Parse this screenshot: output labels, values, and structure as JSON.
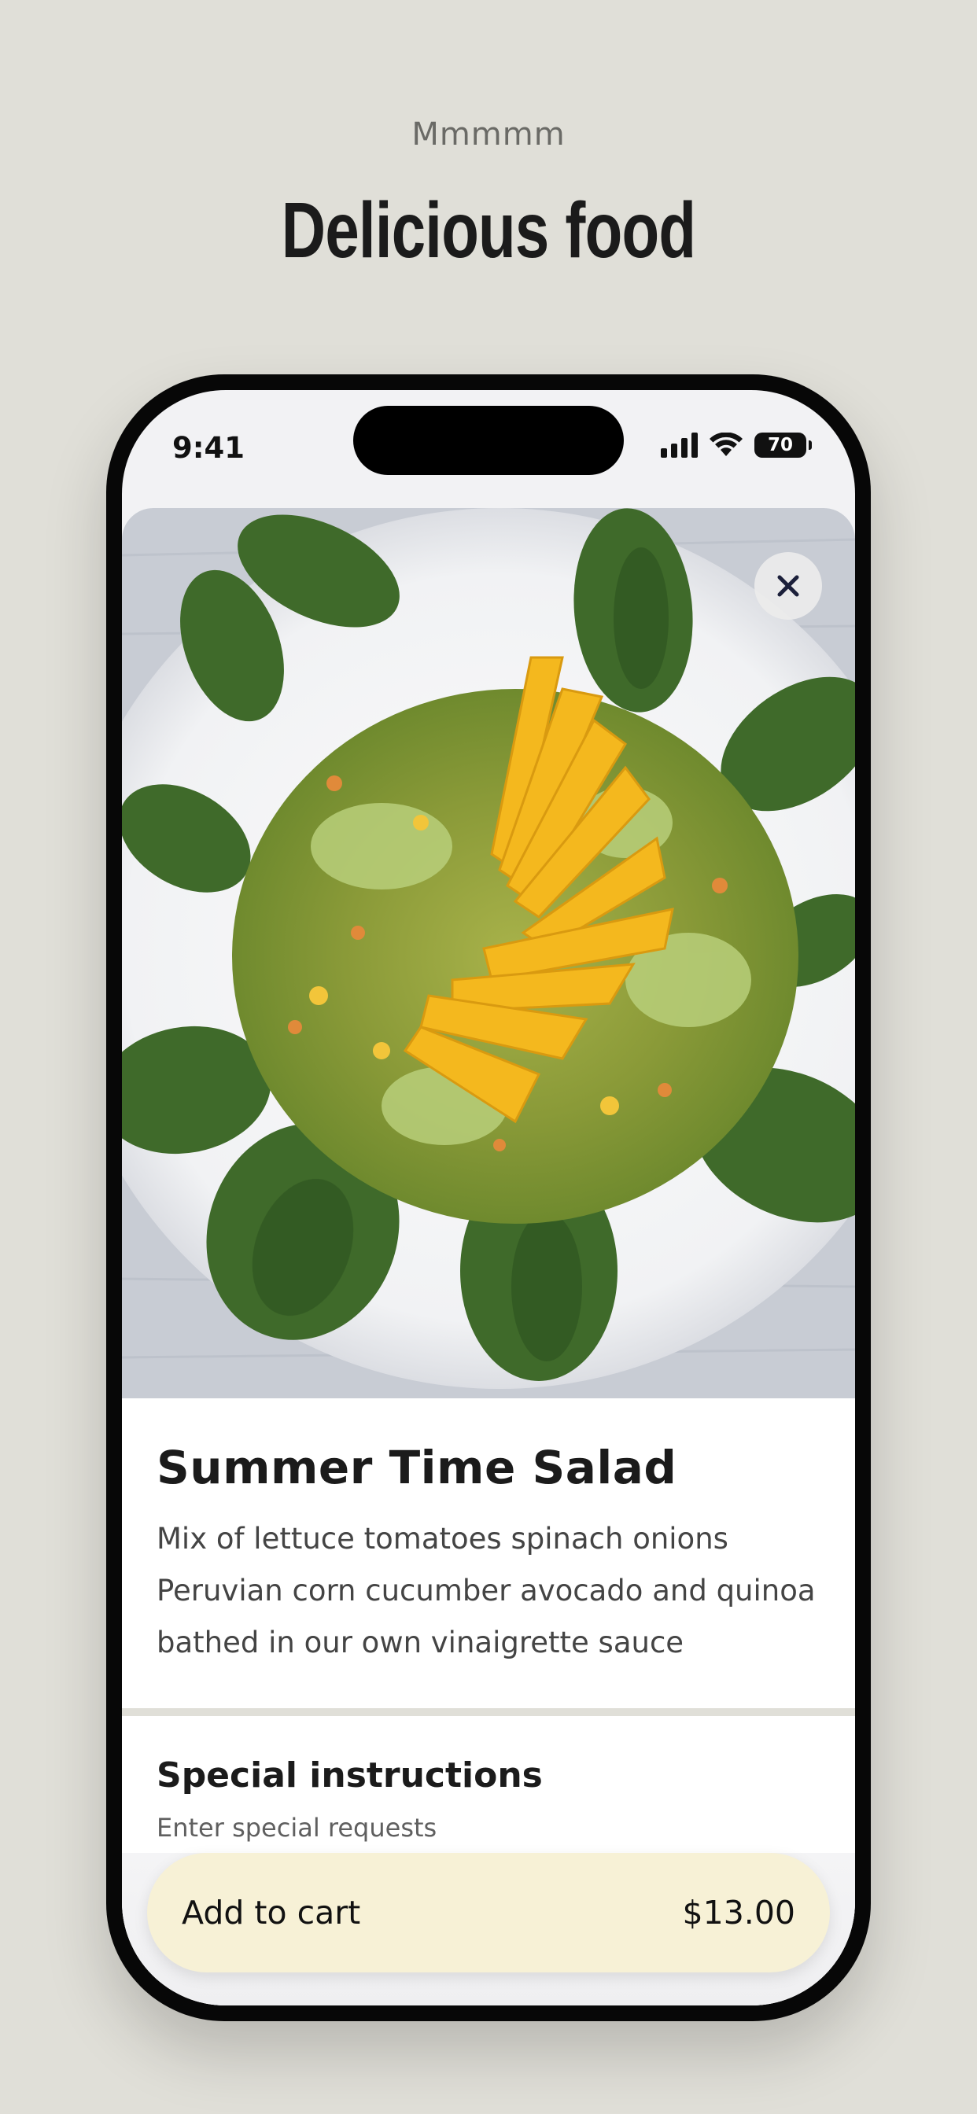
{
  "header": {
    "pre_title": "Mmmmm",
    "title": "Delicious food"
  },
  "status_bar": {
    "time": "9:41",
    "battery": "70",
    "icons": [
      "signal-icon",
      "wifi-icon",
      "battery-icon"
    ]
  },
  "item": {
    "image": "salad-photo",
    "name": "Summer Time Salad",
    "description": "Mix of lettuce tomatoes spinach onions Peruvian corn cucumber avocado and quinoa bathed in our own vinaigrette sauce"
  },
  "instructions": {
    "title": "Special instructions",
    "placeholder": "Enter special requests"
  },
  "cart": {
    "label": "Add to cart",
    "price": "$13.00"
  },
  "colors": {
    "background": "#e0dfd8",
    "cart_button": "#f7f1d6",
    "text_dark": "#1b1b1b"
  }
}
